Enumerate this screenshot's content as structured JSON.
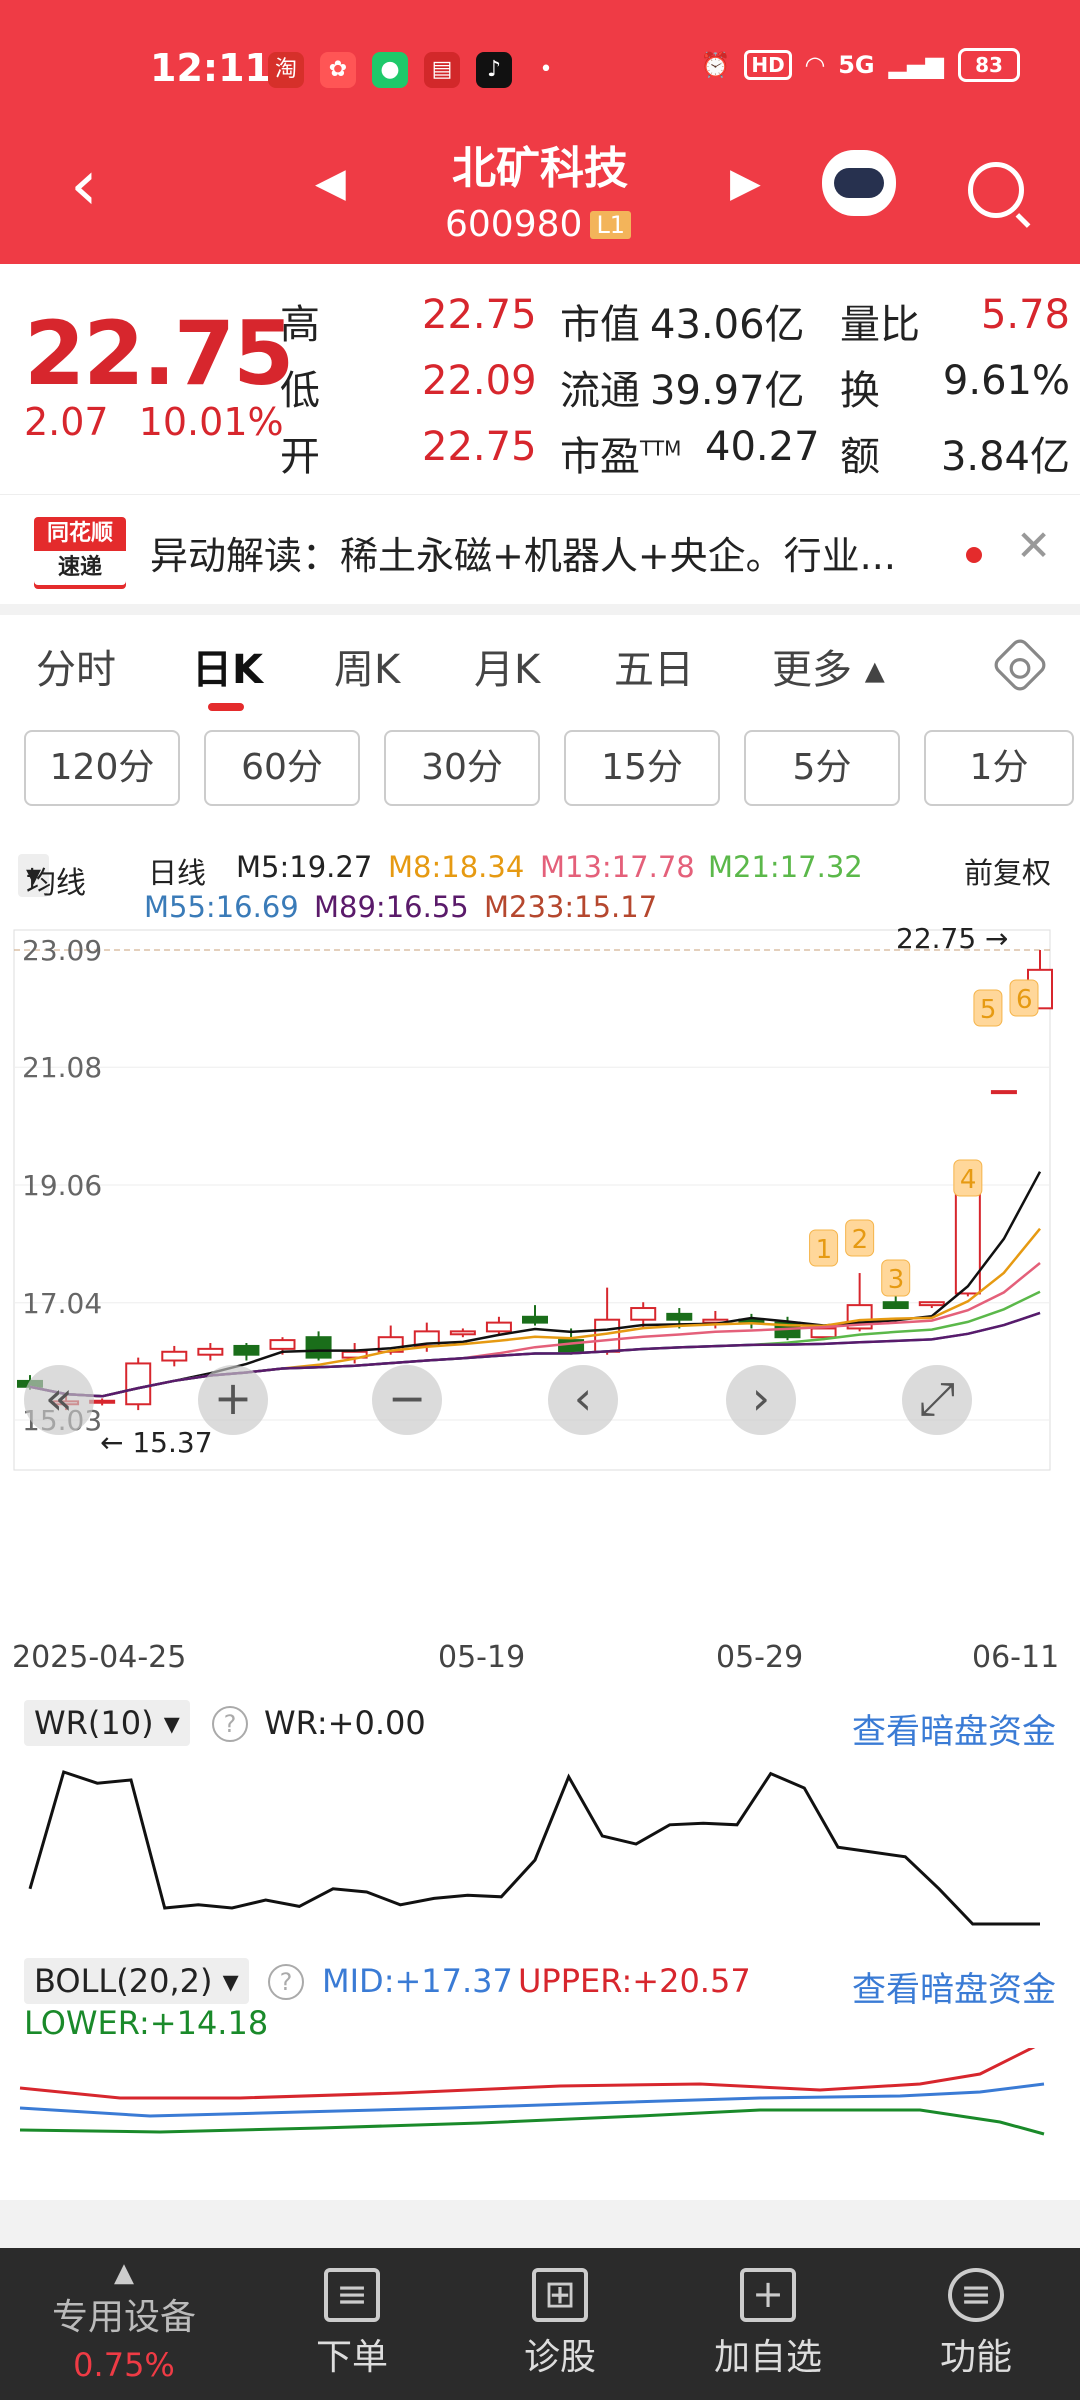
{
  "status_bar": {
    "time": "12:11",
    "signal": "5G",
    "hd": "HD",
    "battery": "83"
  },
  "header": {
    "stock_name": "北矿科技",
    "stock_code": "600980",
    "level": "L1"
  },
  "quote": {
    "price": "22.75",
    "change": "2.07",
    "change_pct": "10.01%",
    "rows": [
      {
        "l1": "高",
        "v1": "22.75",
        "l2": "市值",
        "v2": "43.06亿",
        "l3": "量比",
        "v3": "5.78"
      },
      {
        "l1": "低",
        "v1": "22.09",
        "l2": "流通",
        "v2": "39.97亿",
        "l3": "换",
        "v3": "9.61%"
      },
      {
        "l1": "开",
        "v1": "22.75",
        "l2": "市盈",
        "l2_sup": "TTM",
        "v2": "40.27",
        "l3": "额",
        "v3": "3.84亿"
      }
    ]
  },
  "news": {
    "logo_line1": "同花顺",
    "logo_line2": "速递",
    "text": "异动解读：稀土永磁+机器人+央企。行业..."
  },
  "tabs": [
    "分时",
    "日K",
    "周K",
    "月K",
    "五日",
    "更多"
  ],
  "intervals": [
    "120分",
    "60分",
    "30分",
    "15分",
    "5分",
    "1分"
  ],
  "ma_legend": {
    "selector": "均线",
    "period": "日线",
    "adjust": "前复权",
    "items": [
      {
        "label": "M5:19.27",
        "color": "#111111"
      },
      {
        "label": "M8:18.34",
        "color": "#e69a12"
      },
      {
        "label": "M13:17.78",
        "color": "#e4607a"
      },
      {
        "label": "M21:17.32",
        "color": "#5bb84a"
      },
      {
        "label": "M55:16.69",
        "color": "#3a7bb8"
      },
      {
        "label": "M89:16.55",
        "color": "#5a1a6a"
      },
      {
        "label": "M233:15.17",
        "color": "#b5472e"
      }
    ]
  },
  "chart_data": {
    "type": "candlestick",
    "y_ticks": [
      "23.09",
      "21.08",
      "19.06",
      "17.04",
      "15.03"
    ],
    "ylim": [
      15.03,
      23.09
    ],
    "x_ticks": [
      "2025-04-25",
      "05-19",
      "05-29",
      "06-11"
    ],
    "high_marker": "22.75",
    "low_marker": "15.37",
    "candles": [
      {
        "o": 15.7,
        "h": 15.8,
        "l": 15.55,
        "c": 15.6
      },
      {
        "o": 15.3,
        "h": 15.5,
        "l": 15.2,
        "c": 15.35
      },
      {
        "o": 15.35,
        "h": 15.4,
        "l": 15.28,
        "c": 15.36
      },
      {
        "o": 15.3,
        "h": 16.1,
        "l": 15.2,
        "c": 16.0
      },
      {
        "o": 16.05,
        "h": 16.3,
        "l": 15.95,
        "c": 16.2
      },
      {
        "o": 16.15,
        "h": 16.35,
        "l": 16.05,
        "c": 16.25
      },
      {
        "o": 16.3,
        "h": 16.35,
        "l": 16.05,
        "c": 16.15
      },
      {
        "o": 16.25,
        "h": 16.45,
        "l": 16.15,
        "c": 16.4
      },
      {
        "o": 16.45,
        "h": 16.55,
        "l": 16.05,
        "c": 16.1
      },
      {
        "o": 16.1,
        "h": 16.35,
        "l": 16.0,
        "c": 16.2
      },
      {
        "o": 16.2,
        "h": 16.65,
        "l": 16.15,
        "c": 16.45
      },
      {
        "o": 16.3,
        "h": 16.7,
        "l": 16.2,
        "c": 16.55
      },
      {
        "o": 16.5,
        "h": 16.6,
        "l": 16.45,
        "c": 16.55
      },
      {
        "o": 16.55,
        "h": 16.8,
        "l": 16.5,
        "c": 16.7
      },
      {
        "o": 16.8,
        "h": 17.0,
        "l": 16.65,
        "c": 16.7
      },
      {
        "o": 16.4,
        "h": 16.6,
        "l": 16.15,
        "c": 16.2
      },
      {
        "o": 16.2,
        "h": 17.3,
        "l": 16.15,
        "c": 16.75
      },
      {
        "o": 16.75,
        "h": 17.05,
        "l": 16.6,
        "c": 16.95
      },
      {
        "o": 16.85,
        "h": 16.95,
        "l": 16.6,
        "c": 16.75
      },
      {
        "o": 16.7,
        "h": 16.9,
        "l": 16.6,
        "c": 16.75
      },
      {
        "o": 16.75,
        "h": 16.85,
        "l": 16.6,
        "c": 16.7
      },
      {
        "o": 16.7,
        "h": 16.8,
        "l": 16.4,
        "c": 16.45
      },
      {
        "o": 16.45,
        "h": 16.65,
        "l": 16.4,
        "c": 16.6
      },
      {
        "o": 16.6,
        "h": 17.55,
        "l": 16.55,
        "c": 17.0
      },
      {
        "o": 17.05,
        "h": 17.45,
        "l": 16.95,
        "c": 16.95
      },
      {
        "o": 17.0,
        "h": 17.05,
        "l": 16.95,
        "c": 17.05
      },
      {
        "o": 17.2,
        "h": 19.15,
        "l": 17.15,
        "c": 19.02
      },
      {
        "o": 20.67,
        "h": 20.67,
        "l": 20.67,
        "c": 20.67
      },
      {
        "o": 22.09,
        "h": 23.09,
        "l": 22.09,
        "c": 22.75
      }
    ],
    "badges": [
      "1",
      "2",
      "3",
      "4",
      "5",
      "6"
    ]
  },
  "overlay_controls": [
    "«",
    "+",
    "−",
    "‹",
    "›",
    "⤢"
  ],
  "wr": {
    "selector": "WR(10)",
    "value_label": "WR:+0.00",
    "link": "查看暗盘资金",
    "values": [
      78,
      5,
      12,
      10,
      90,
      88,
      90,
      85,
      89,
      78,
      80,
      88,
      84,
      82,
      83,
      60,
      8,
      45,
      50,
      38,
      37,
      38,
      6,
      15,
      52,
      55,
      58,
      78,
      100,
      100,
      100
    ]
  },
  "boll": {
    "selector": "BOLL(20,2)",
    "mid": "MID:+17.37",
    "upper": "UPPER:+20.57",
    "lower": "LOWER:+14.18",
    "link": "查看暗盘资金"
  },
  "bottom_nav": [
    {
      "label": "专用设备",
      "sub": "0.75%"
    },
    {
      "label": "下单"
    },
    {
      "label": "诊股"
    },
    {
      "label": "加自选"
    },
    {
      "label": "功能"
    }
  ]
}
